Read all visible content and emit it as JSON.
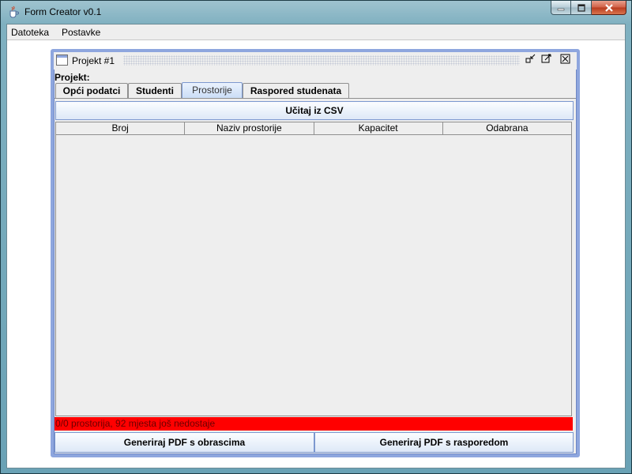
{
  "window": {
    "title": "Form Creator v0.1",
    "icon": "java-cup-icon"
  },
  "menubar": {
    "items": [
      "Datoteka",
      "Postavke"
    ]
  },
  "internal_frame": {
    "title": "Projekt #1",
    "project_label": "Projekt:",
    "tabs": [
      {
        "label": "Opći podatci",
        "active": false
      },
      {
        "label": "Studenti",
        "active": false
      },
      {
        "label": "Prostorije",
        "active": true
      },
      {
        "label": "Raspored studenata",
        "active": false
      }
    ],
    "load_button": "Učitaj iz CSV",
    "table": {
      "columns": [
        "Broj",
        "Naziv prostorije",
        "Kapacitet",
        "Odabrana"
      ],
      "rows": []
    },
    "status_text": "0/0 prostorija, 92 mjesta još nedostaje",
    "status_color": "#ff0000",
    "buttons": {
      "generate_forms": "Generiraj PDF s obrascima",
      "generate_schedule": "Generiraj PDF s rasporedom"
    }
  }
}
